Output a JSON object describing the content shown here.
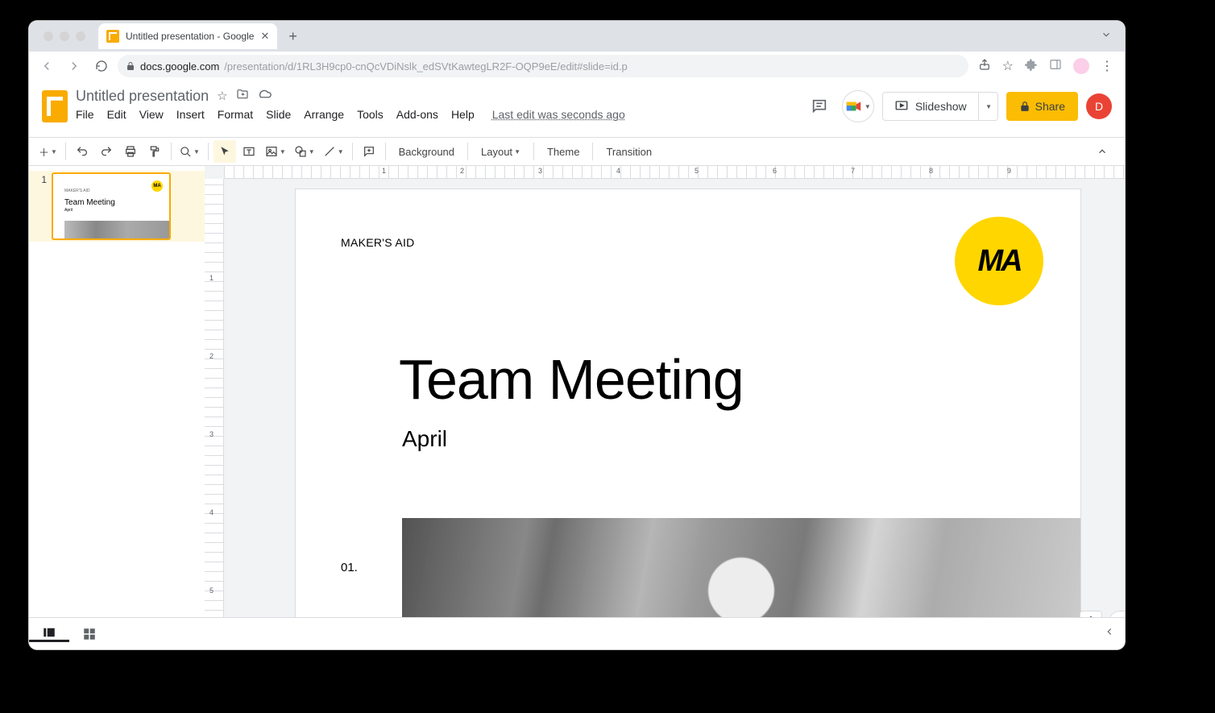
{
  "browser": {
    "tab_title": "Untitled presentation - Google",
    "url_host": "docs.google.com",
    "url_path": "/presentation/d/1RL3H9cp0-cnQcVDiNslk_edSVtKawtegLR2F-OQP9eE/edit#slide=id.p"
  },
  "header": {
    "doc_title": "Untitled presentation",
    "last_edit": "Last edit was seconds ago",
    "slideshow": "Slideshow",
    "share": "Share",
    "profile_initial": "D"
  },
  "menubar": {
    "file": "File",
    "edit": "Edit",
    "view": "View",
    "insert": "Insert",
    "format": "Format",
    "slide": "Slide",
    "arrange": "Arrange",
    "tools": "Tools",
    "addons": "Add-ons",
    "help": "Help"
  },
  "toolbar": {
    "background": "Background",
    "layout": "Layout",
    "theme": "Theme",
    "transition": "Transition"
  },
  "filmstrip": {
    "slide_num": "1",
    "thumb_title": "Team Meeting",
    "thumb_sub": "April",
    "thumb_badge": "MA",
    "thumb_company": "MAKER'S AID"
  },
  "slide": {
    "company": "MAKER'S AID",
    "logo": "MA",
    "title": "Team Meeting",
    "subtitle": "April",
    "page_num": "01."
  },
  "ruler_h": [
    "1",
    "2",
    "3",
    "4",
    "5",
    "6",
    "7",
    "8",
    "9"
  ],
  "ruler_v": [
    "1",
    "2",
    "3",
    "4",
    "5"
  ]
}
